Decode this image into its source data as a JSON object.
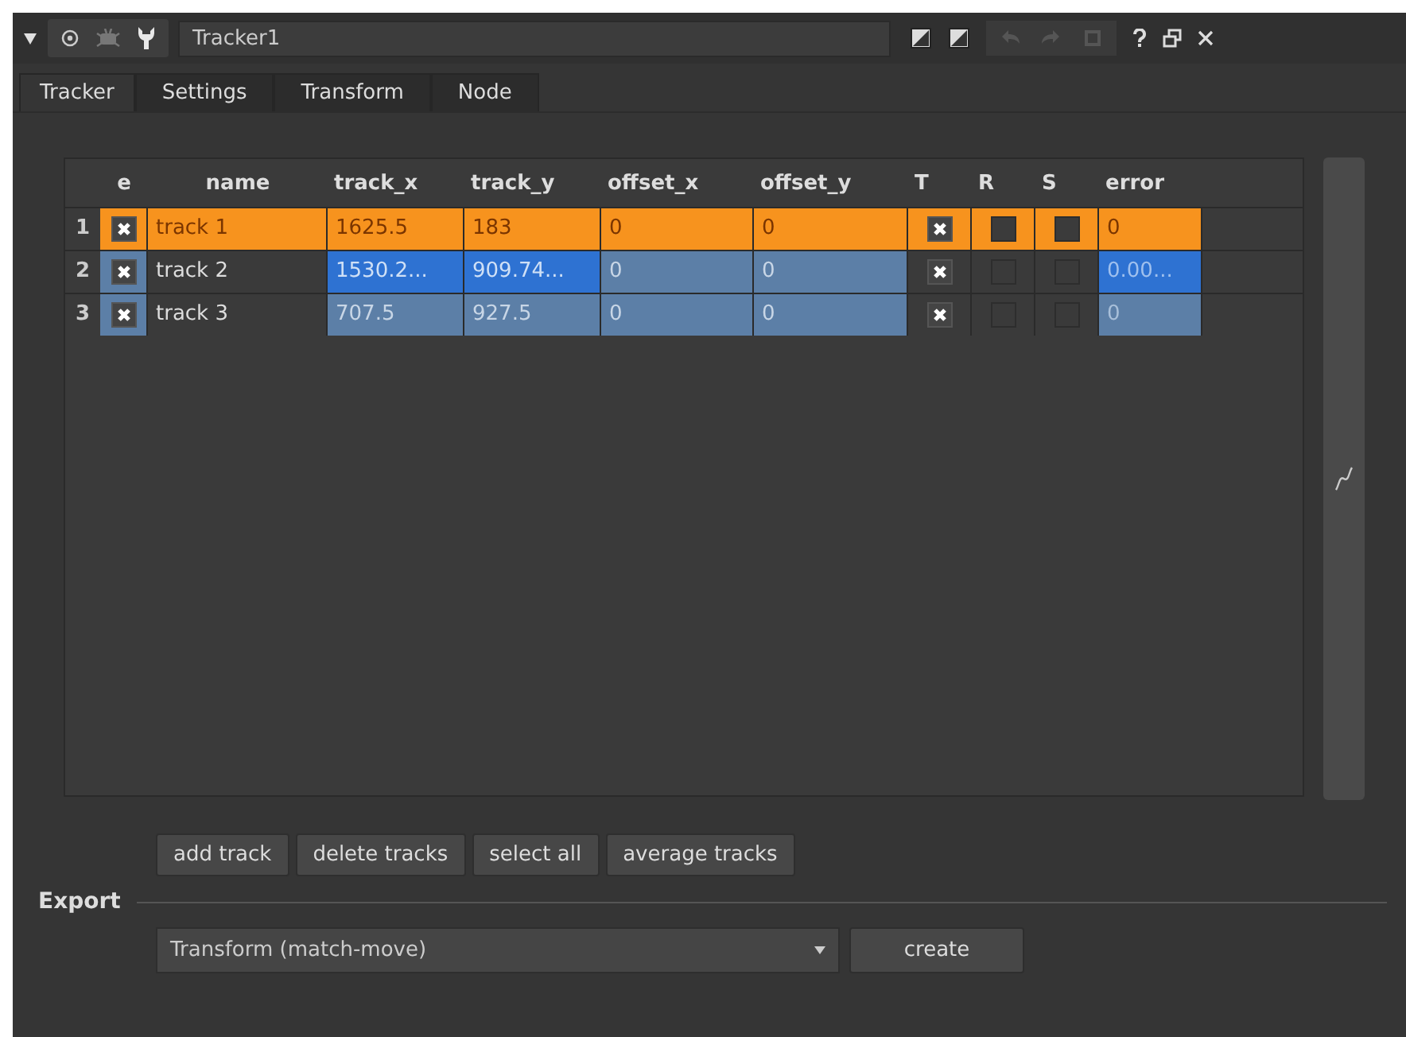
{
  "toolbar": {
    "title": "Tracker1"
  },
  "tabs": [
    {
      "label": "Tracker",
      "selected": true
    },
    {
      "label": "Settings",
      "selected": false
    },
    {
      "label": "Transform",
      "selected": false
    },
    {
      "label": "Node",
      "selected": false
    }
  ],
  "table": {
    "columns": [
      "e",
      "name",
      "track_x",
      "track_y",
      "offset_x",
      "offset_y",
      "T",
      "R",
      "S",
      "error"
    ],
    "rows": [
      {
        "number": "1",
        "selected": true,
        "e": true,
        "name": "track 1",
        "values": [
          {
            "text": "1625.5"
          },
          {
            "text": "183"
          },
          {
            "text": "0"
          },
          {
            "text": "0"
          }
        ],
        "t": true,
        "r": false,
        "s": false,
        "error": {
          "text": "0",
          "faded": false
        }
      },
      {
        "number": "2",
        "selected": false,
        "e": true,
        "name": "track 2",
        "values": [
          {
            "text": "1530.2...",
            "keyed": true
          },
          {
            "text": "909.74...",
            "keyed": true
          },
          {
            "text": "0",
            "keyed": false
          },
          {
            "text": "0",
            "keyed": false
          }
        ],
        "t": true,
        "r": false,
        "s": false,
        "error": {
          "text": "0.00...",
          "keyed": true,
          "faded": true
        }
      },
      {
        "number": "3",
        "selected": false,
        "e": true,
        "name": "track 3",
        "values": [
          {
            "text": "707.5",
            "keyed": false
          },
          {
            "text": "927.5",
            "keyed": false
          },
          {
            "text": "0",
            "keyed": false
          },
          {
            "text": "0",
            "keyed": false
          }
        ],
        "t": true,
        "r": false,
        "s": false,
        "error": {
          "text": "0",
          "keyed": false,
          "faded": true
        }
      }
    ]
  },
  "track_buttons": [
    "add track",
    "delete tracks",
    "select all",
    "average tracks"
  ],
  "export": {
    "label": "Export",
    "dropdown": "Transform (match-move)",
    "button": "create"
  }
}
